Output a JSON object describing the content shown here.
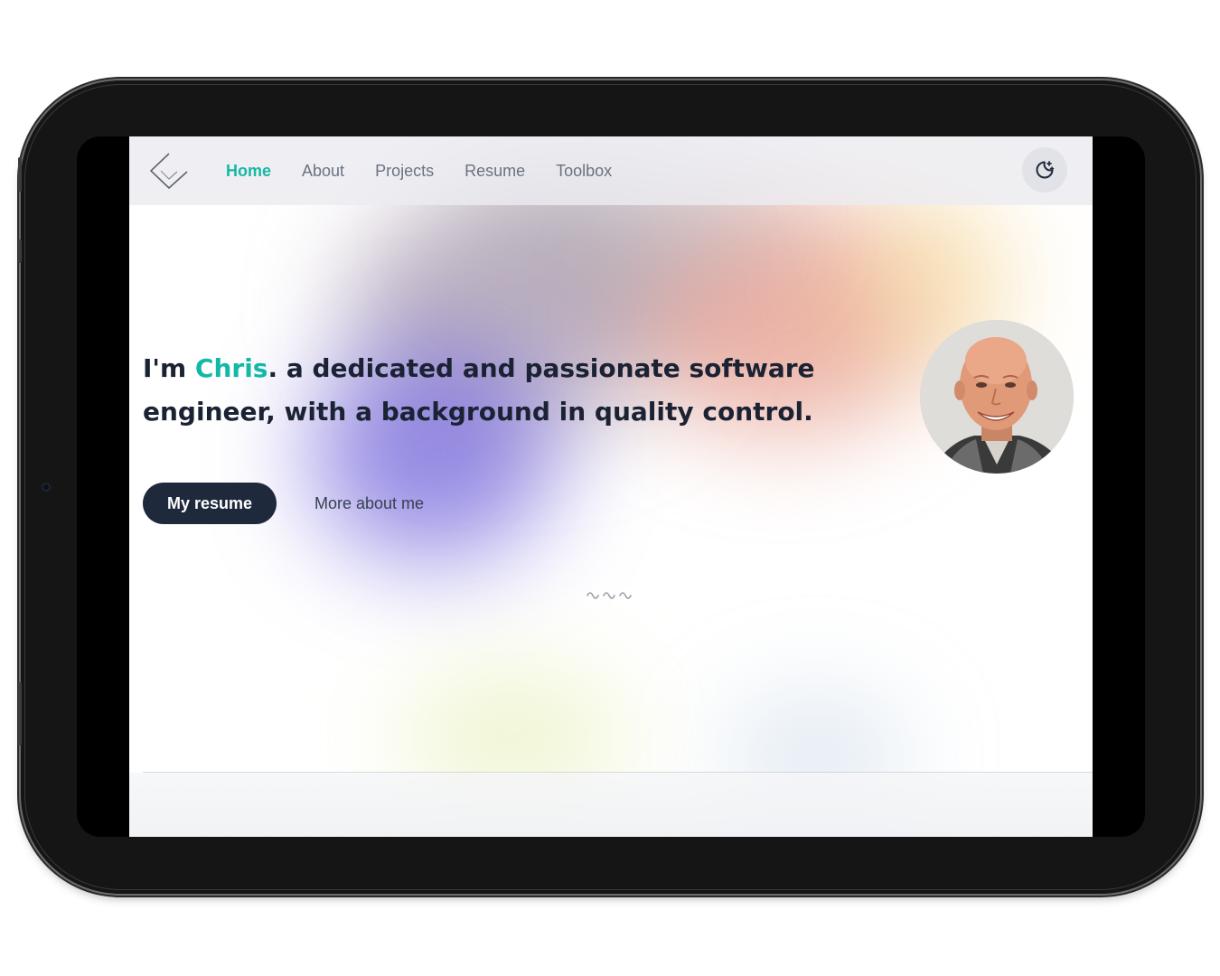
{
  "nav": {
    "links": [
      {
        "label": "Home",
        "active": true
      },
      {
        "label": "About",
        "active": false
      },
      {
        "label": "Projects",
        "active": false
      },
      {
        "label": "Resume",
        "active": false
      },
      {
        "label": "Toolbox",
        "active": false
      }
    ],
    "theme_toggle_icon": "moon-stars-icon",
    "logo_icon": "chevron-diamond-logo"
  },
  "hero": {
    "intro_prefix": "I'm ",
    "name": "Chris",
    "intro_suffix": ". a dedicated and passionate software engineer, with a background in quality control.",
    "primary_button": "My resume",
    "secondary_link": "More about me",
    "scroll_icon": "squiggle-icon"
  },
  "colors": {
    "accent": "#14b8a6",
    "text_dark": "#1a2233",
    "button_bg": "#1e293b",
    "nav_text": "#6b7280"
  }
}
